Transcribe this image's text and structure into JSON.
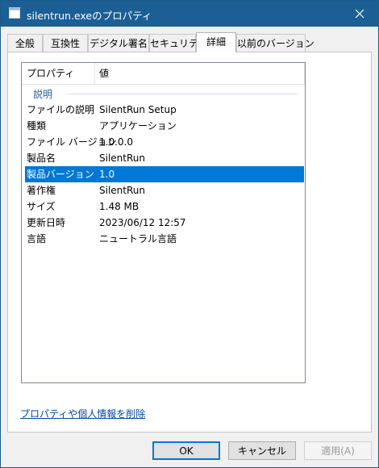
{
  "window": {
    "title": "silentrun.exeのプロパティ"
  },
  "tabs": [
    {
      "label": "全般"
    },
    {
      "label": "互換性"
    },
    {
      "label": "デジタル署名"
    },
    {
      "label": "セキュリティ"
    },
    {
      "label": "詳細",
      "active": true
    },
    {
      "label": "以前のバージョン"
    }
  ],
  "details": {
    "columns": {
      "property": "プロパティ",
      "value": "値"
    },
    "group_label": "説明",
    "rows": [
      {
        "key": "ファイルの説明",
        "value": "SilentRun Setup"
      },
      {
        "key": "種類",
        "value": "アプリケーション"
      },
      {
        "key": "ファイル バージョン",
        "value": "1.0.0.0"
      },
      {
        "key": "製品名",
        "value": "SilentRun"
      },
      {
        "key": "製品バージョン",
        "value": "1.0",
        "selected": true
      },
      {
        "key": "著作権",
        "value": "SilentRun"
      },
      {
        "key": "サイズ",
        "value": "1.48 MB"
      },
      {
        "key": "更新日時",
        "value": "2023/06/12 12:57"
      },
      {
        "key": "言語",
        "value": "ニュートラル言語"
      }
    ]
  },
  "remove_link": "プロパティや個人情報を削除",
  "buttons": {
    "ok": "OK",
    "cancel": "キャンセル",
    "apply": "適用(A)"
  },
  "colors": {
    "titlebar": "#1b5f94",
    "selection": "#0078d7",
    "link": "#0048a8",
    "group_label": "#1d5faa"
  },
  "icons": {
    "title": "application-window-icon",
    "close": "close-icon"
  }
}
